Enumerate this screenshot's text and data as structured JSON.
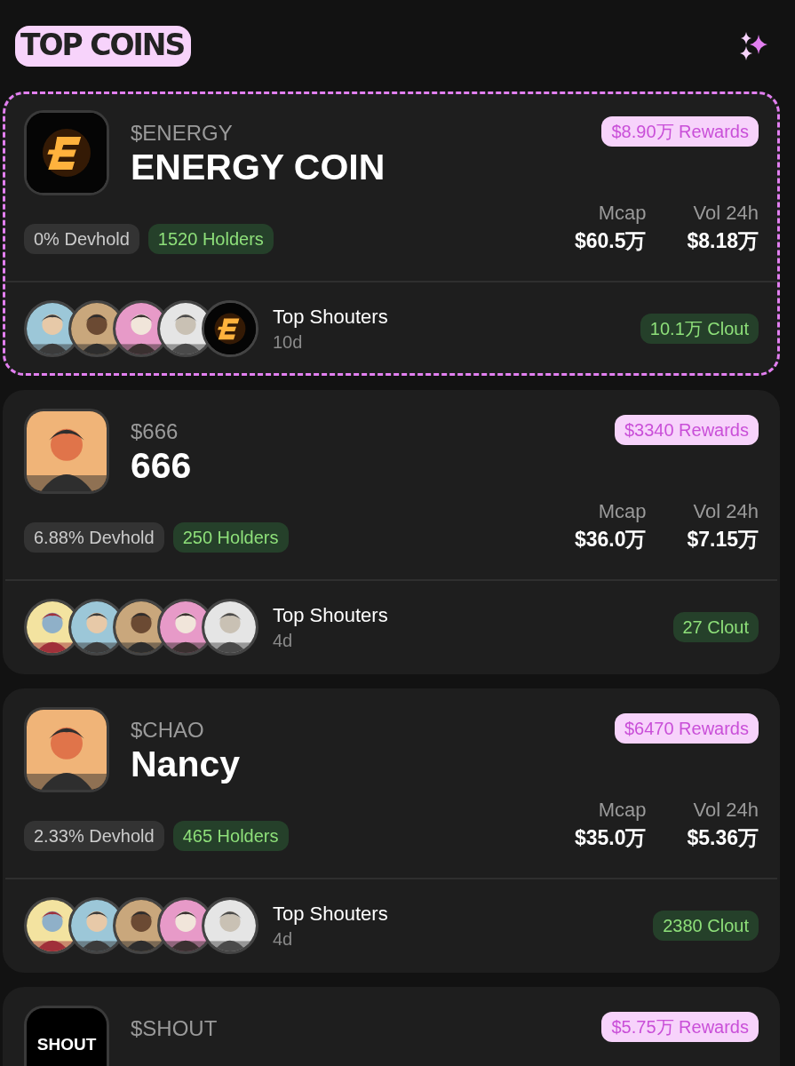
{
  "header": {
    "title": "TOP COINS"
  },
  "coins": [
    {
      "featured": true,
      "avatar": {
        "kind": "logo"
      },
      "ticker": "$ENERGY",
      "name": "ENERGY COIN",
      "rewards": "$8.90万 Rewards",
      "devhold": "0% Devhold",
      "holders": "1520 Holders",
      "mcap_label": "Mcap",
      "mcap": "$60.5万",
      "vol_label": "Vol 24h",
      "vol": "$8.18万",
      "shouters": [
        {
          "kind": "picture"
        },
        {
          "kind": "picture"
        },
        {
          "kind": "picture"
        },
        {
          "kind": "picture"
        },
        {
          "kind": "logo"
        }
      ],
      "shouters_label": "Top Shouters",
      "age": "10d",
      "clout": "10.1万 Clout"
    },
    {
      "featured": false,
      "avatar": {
        "kind": "picture"
      },
      "ticker": "$666",
      "name": "666",
      "rewards": "$3340 Rewards",
      "devhold": "6.88% Devhold",
      "holders": "250 Holders",
      "mcap_label": "Mcap",
      "mcap": "$36.0万",
      "vol_label": "Vol 24h",
      "vol": "$7.15万",
      "shouters": [
        {
          "kind": "picture"
        },
        {
          "kind": "picture"
        },
        {
          "kind": "picture"
        },
        {
          "kind": "picture"
        },
        {
          "kind": "picture"
        }
      ],
      "shouters_label": "Top Shouters",
      "age": "4d",
      "clout": "27 Clout"
    },
    {
      "featured": false,
      "avatar": {
        "kind": "picture"
      },
      "ticker": "$CHAO",
      "name": "Nancy",
      "rewards": "$6470 Rewards",
      "devhold": "2.33% Devhold",
      "holders": "465 Holders",
      "mcap_label": "Mcap",
      "mcap": "$35.0万",
      "vol_label": "Vol 24h",
      "vol": "$5.36万",
      "shouters": [
        {
          "kind": "picture"
        },
        {
          "kind": "picture"
        },
        {
          "kind": "picture"
        },
        {
          "kind": "picture"
        },
        {
          "kind": "picture"
        }
      ],
      "shouters_label": "Top Shouters",
      "age": "4d",
      "clout": "2380 Clout"
    },
    {
      "featured": false,
      "avatar": {
        "kind": "text-logo",
        "text": "SHOUT"
      },
      "ticker": "$SHOUT",
      "rewards": "$5.75万 Rewards"
    }
  ]
}
